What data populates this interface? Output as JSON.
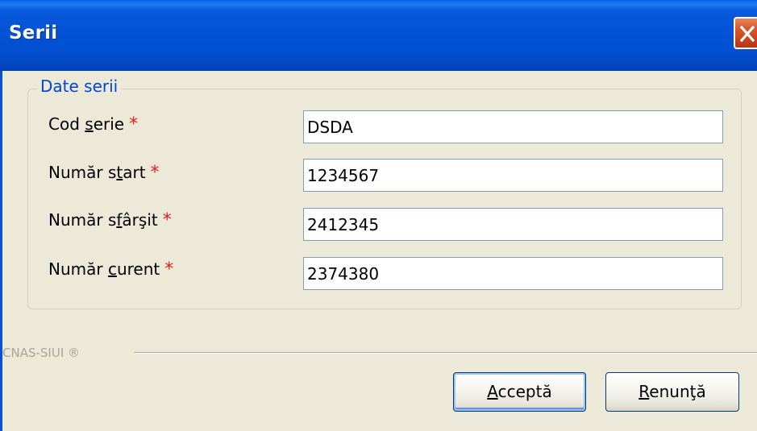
{
  "window": {
    "title": "Serii"
  },
  "icons": {
    "close": "close-icon"
  },
  "group": {
    "legend": "Date serii"
  },
  "fields": [
    {
      "label_pre": "Cod ",
      "label_mnemonic": "s",
      "label_post": "erie",
      "required_mark": "*",
      "value": "DSDA"
    },
    {
      "label_pre": "Număr s",
      "label_mnemonic": "t",
      "label_post": "art",
      "required_mark": "*",
      "value": "1234567"
    },
    {
      "label_pre": "Număr s",
      "label_mnemonic": "f",
      "label_post": "ârşit",
      "required_mark": "*",
      "value": "2412345"
    },
    {
      "label_pre": "Număr ",
      "label_mnemonic": "c",
      "label_post": "urent",
      "required_mark": "*",
      "value": "2374380"
    }
  ],
  "footer": {
    "brand": "CNAS-SIUI ®"
  },
  "buttons": {
    "accept": {
      "mnemonic": "A",
      "rest": "cceptă"
    },
    "cancel": {
      "mnemonic": "R",
      "rest": "enunţă"
    }
  },
  "colors": {
    "titlebar": "#0453d6",
    "dialog_bg": "#ece9d8",
    "legend_text": "#0046d5",
    "required": "#e0201e",
    "close_button": "#d9572d"
  }
}
